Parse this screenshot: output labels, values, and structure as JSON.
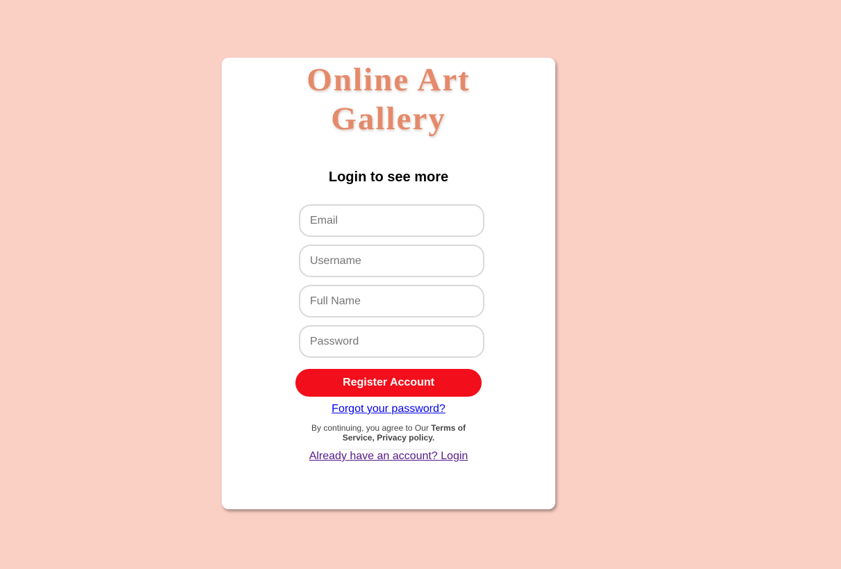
{
  "brand": {
    "title_line1": "Online Art",
    "title_line2": "Gallery"
  },
  "form": {
    "heading": "Login to see more",
    "email_placeholder": "Email",
    "username_placeholder": "Username",
    "fullname_placeholder": "Full Name",
    "password_placeholder": "Password",
    "submit_label": "Register Account"
  },
  "links": {
    "forgot_password": "Forgot your password?",
    "login": "Already have an account? Login"
  },
  "terms": {
    "prefix": "By continuing, you agree to Our ",
    "terms_of_service": "Terms of Service,",
    "privacy_policy": " Privacy policy."
  },
  "colors": {
    "background": "#facfc4",
    "brand": "#e48a6b",
    "button": "#f20e1a"
  }
}
